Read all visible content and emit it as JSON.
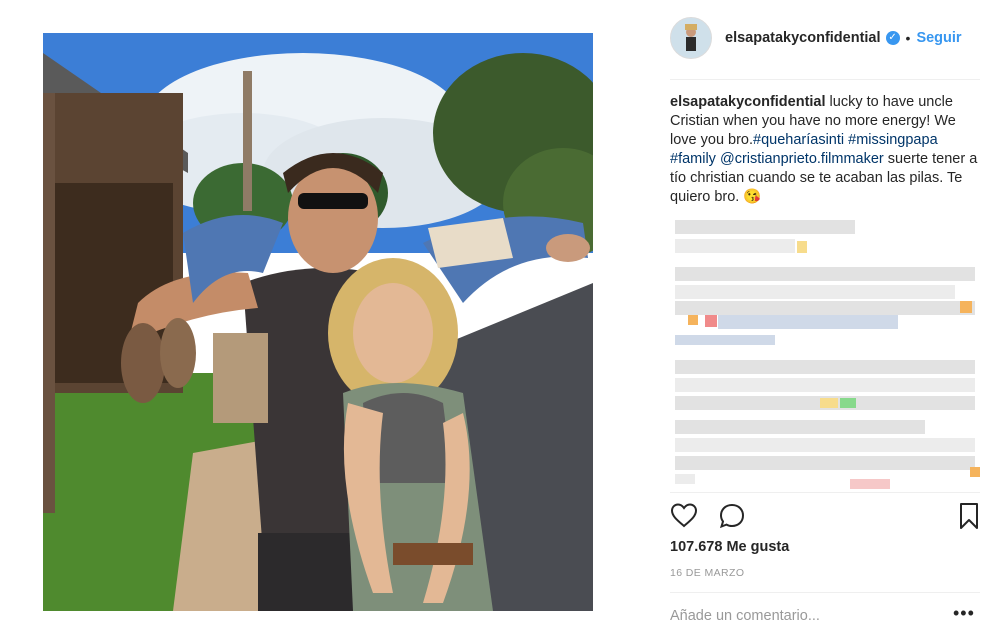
{
  "post": {
    "username": "elsapatakyconfidential",
    "verified_icon": "verified-badge-icon",
    "dot": "•",
    "follow_label": "Seguir",
    "caption": {
      "author": "elsapatakyconfidential",
      "text1": " lucky to have uncle Cristian when you have no more energy! We love you bro.",
      "tag1": "#queharíasinti",
      "text2": " ",
      "tag2": "#missingpapa",
      "text3": " ",
      "tag3": "#family",
      "text4": " ",
      "mention": "@cristianprieto.filmmaker",
      "text5": " suerte tener a tío christian cuando se te acaban las pilas. Te quiero bro. ",
      "emoji": "😘"
    },
    "likes": "107.678 Me gusta",
    "date": "16 DE MARZO",
    "comment_placeholder": "Añade un comentario...",
    "more_label": "•••",
    "icons": [
      "heart-icon",
      "comment-icon",
      "bookmark-icon"
    ],
    "colors": {
      "link": "#003569",
      "accent": "#3897f0",
      "muted": "#999999"
    }
  }
}
